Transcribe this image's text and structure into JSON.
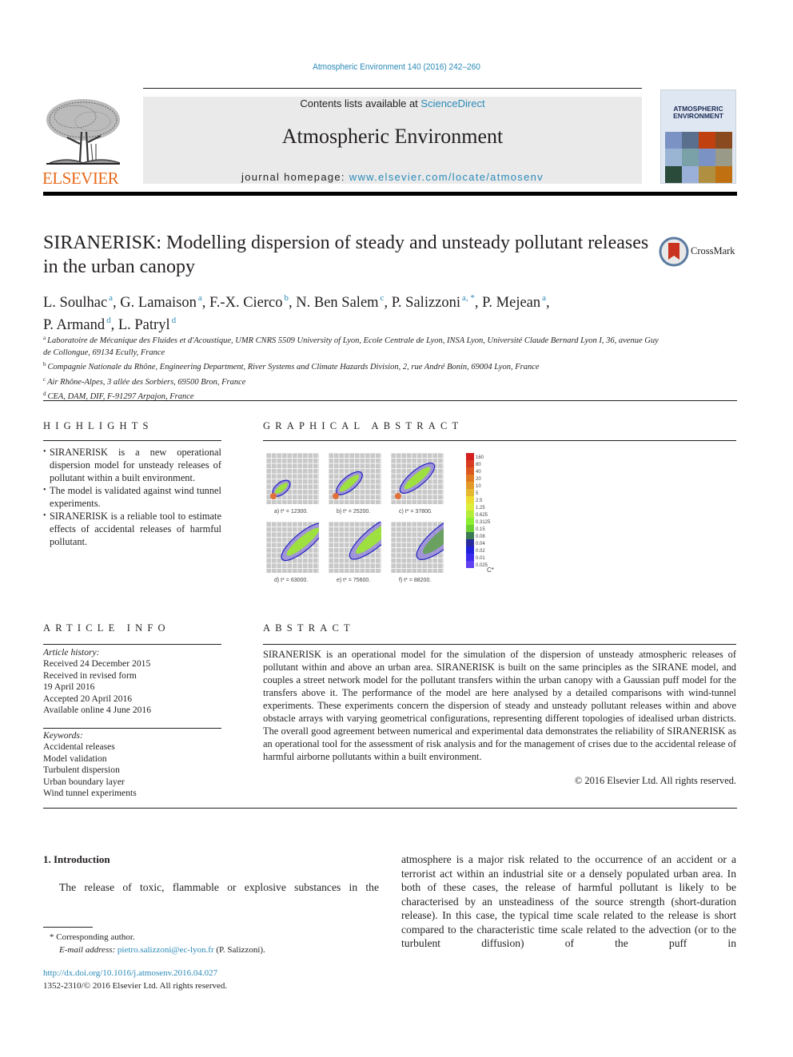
{
  "header": {
    "citation": "Atmospheric Environment 140 (2016) 242–260",
    "contents_prefix": "Contents lists available at ",
    "contents_link": "ScienceDirect",
    "journal_title": "Atmospheric Environment",
    "homepage_prefix": "journal homepage: ",
    "homepage_link": "www.elsevier.com/locate/atmosenv",
    "publisher": "ELSEVIER",
    "cover_title_1": "ATMOSPHERIC",
    "cover_title_2": "ENVIRONMENT",
    "crossmark": "CrossMark"
  },
  "article": {
    "title": "SIRANERISK: Modelling dispersion of steady and unsteady pollutant releases in the urban canopy",
    "authors": [
      {
        "name": "L. Soulhac",
        "aff": "a"
      },
      {
        "name": "G. Lamaison",
        "aff": "a"
      },
      {
        "name": "F.-X. Cierco",
        "aff": "b"
      },
      {
        "name": "N. Ben Salem",
        "aff": "c"
      },
      {
        "name": "P. Salizzoni",
        "aff": "a, *"
      },
      {
        "name": "P. Mejean",
        "aff": "a"
      },
      {
        "name": "P. Armand",
        "aff": "d"
      },
      {
        "name": "L. Patryl",
        "aff": "d"
      }
    ],
    "affiliations": [
      {
        "key": "a",
        "text": "Laboratoire de Mécanique des Fluides et d'Acoustique, UMR CNRS 5509 University of Lyon, Ecole Centrale de Lyon, INSA Lyon, Université Claude Bernard Lyon I, 36, avenue Guy de Collongue, 69134 Ecully, France"
      },
      {
        "key": "b",
        "text": "Compagnie Nationale du Rhône, Engineering Department, River Systems and Climate Hazards Division, 2, rue André Bonin, 69004 Lyon, France"
      },
      {
        "key": "c",
        "text": "Air Rhône-Alpes, 3 allée des Sorbiers, 69500 Bron, France"
      },
      {
        "key": "d",
        "text": "CEA, DAM, DIF, F-91297 Arpajon, France"
      }
    ]
  },
  "highlights": {
    "heading": "HIGHLIGHTS",
    "items": [
      "SIRANERISK is a new operational dispersion model for unsteady releases of pollutant within a built environment.",
      "The model is validated against wind tunnel experiments.",
      "SIRANERISK is a reliable tool to estimate effects of accidental releases of harmful pollutant."
    ]
  },
  "graphical_abstract": {
    "heading": "GRAPHICAL ABSTRACT",
    "panels": [
      {
        "caption": "a) t* = 12300.",
        "stage": 1
      },
      {
        "caption": "b) t* = 25200.",
        "stage": 2
      },
      {
        "caption": "c) t* = 37800.",
        "stage": 3
      },
      {
        "caption": "d) t* = 63000.",
        "stage": 4
      },
      {
        "caption": "e) t* = 75600.",
        "stage": 5
      },
      {
        "caption": "f) t* = 88200.",
        "stage": 6
      }
    ],
    "colorbar": {
      "label": "C*",
      "levels": [
        "160",
        "80",
        "40",
        "20",
        "10",
        "5",
        "2.5",
        "1.25",
        "0.625",
        "0.3125",
        "0.15",
        "0.08",
        "0.04",
        "0.02",
        "0.01",
        "0.025"
      ],
      "colors": [
        "#d42020",
        "#d83c20",
        "#dc5820",
        "#e07a20",
        "#e49a28",
        "#e6b830",
        "#ecdc30",
        "#dcee3a",
        "#b4ee3a",
        "#8cee30",
        "#6cd030",
        "#3c7a55",
        "#2a2aa0",
        "#2020dc",
        "#3a2af0",
        "#6040f0"
      ]
    }
  },
  "article_info": {
    "heading": "ARTICLE INFO",
    "history_label": "Article history:",
    "history": [
      "Received 24 December 2015",
      "Received in revised form",
      "19 April 2016",
      "Accepted 20 April 2016",
      "Available online 4 June 2016"
    ],
    "keywords_label": "Keywords:",
    "keywords": [
      "Accidental releases",
      "Model validation",
      "Turbulent dispersion",
      "Urban boundary layer",
      "Wind tunnel experiments"
    ]
  },
  "abstract": {
    "heading": "ABSTRACT",
    "text": "SIRANERISK is an operational model for the simulation of the dispersion of unsteady atmospheric releases of pollutant within and above an urban area. SIRANERISK is built on the same principles as the SIRANE model, and couples a street network model for the pollutant transfers within the urban canopy with a Gaussian puff model for the transfers above it. The performance of the model are here analysed by a detailed comparisons with wind-tunnel experiments. These experiments concern the dispersion of steady and unsteady pollutant releases within and above obstacle arrays with varying geometrical configurations, representing different topologies of idealised urban districts. The overall good agreement between numerical and experimental data demonstrates the reliability of SIRANERISK as an operational tool for the assessment of risk analysis and for the management of crises due to the accidental release of harmful airborne pollutants within a built environment.",
    "copyright": "© 2016 Elsevier Ltd. All rights reserved."
  },
  "introduction": {
    "heading": "1.  Introduction",
    "left_text": "The release of toxic, flammable or explosive substances in the",
    "right_text": "atmosphere is a major risk related to the occurrence of an accident or a terrorist act within an industrial site or a densely populated urban area. In both of these cases, the release of harmful pollutant is likely to be characterised by an unsteadiness of the source strength (short-duration release). In this case, the typical time scale related to the release is short compared to the characteristic time scale related to the advection (or to the turbulent diffusion) of the puff in"
  },
  "footnote": {
    "corresponding": "* Corresponding author.",
    "email_label": "E-mail address: ",
    "email": "pietro.salizzoni@ec-lyon.fr",
    "email_suffix": " (P. Salizzoni).",
    "doi": "http://dx.doi.org/10.1016/j.atmosenv.2016.04.027",
    "issn": "1352-2310/© 2016 Elsevier Ltd. All rights reserved."
  }
}
